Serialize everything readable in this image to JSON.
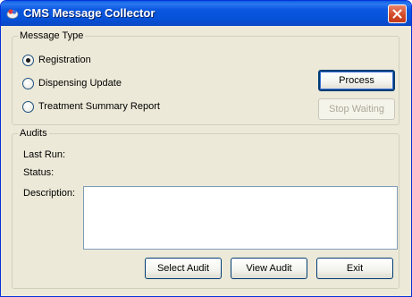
{
  "window": {
    "title": "CMS Message Collector"
  },
  "message_type": {
    "legend": "Message Type",
    "options": [
      {
        "label": "Registration",
        "selected": true
      },
      {
        "label": "Dispensing Update",
        "selected": false
      },
      {
        "label": "Treatment Summary Report",
        "selected": false
      }
    ],
    "process_label": "Process",
    "stop_label": "Stop Waiting"
  },
  "audits": {
    "legend": "Audits",
    "last_run_label": "Last Run:",
    "status_label": "Status:",
    "description_label": "Description:",
    "description_value": ""
  },
  "footer": {
    "select_audit_label": "Select Audit",
    "view_audit_label": "View Audit",
    "exit_label": "Exit"
  },
  "colors": {
    "titlebar": "#0652d8",
    "window_bg": "#ece9d8",
    "close_button": "#d24b2a",
    "radio_selected_dot": "#21a121",
    "disabled_text": "#aca899"
  }
}
